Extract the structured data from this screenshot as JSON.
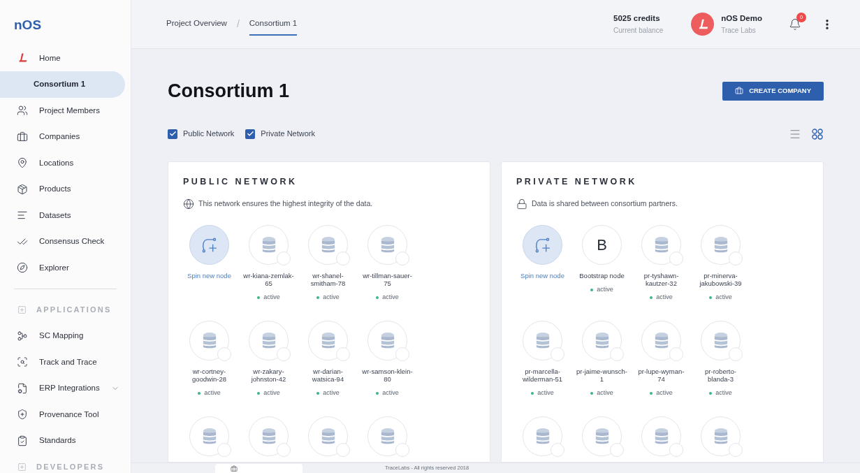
{
  "sidebar": {
    "logo": "nOS",
    "items": [
      {
        "kind": "item",
        "label": "Home",
        "selected": false
      },
      {
        "kind": "item",
        "label": "Consortium 1",
        "selected": true
      },
      {
        "kind": "item",
        "label": "Project Members",
        "selected": false
      },
      {
        "kind": "item",
        "label": "Companies",
        "selected": false
      },
      {
        "kind": "item",
        "label": "Locations",
        "selected": false
      },
      {
        "kind": "item",
        "label": "Products",
        "selected": false
      },
      {
        "kind": "item",
        "label": "Datasets",
        "selected": false
      },
      {
        "kind": "item",
        "label": "Consensus Check",
        "selected": false
      },
      {
        "kind": "item",
        "label": "Explorer",
        "selected": false
      },
      {
        "kind": "divider"
      },
      {
        "kind": "section",
        "label": "APPLICATIONS"
      },
      {
        "kind": "item",
        "label": "SC Mapping",
        "selected": false
      },
      {
        "kind": "item",
        "label": "Track and Trace",
        "selected": false
      },
      {
        "kind": "item",
        "label": "ERP Integrations",
        "selected": false,
        "expanded": false
      },
      {
        "kind": "item",
        "label": "Provenance Tool",
        "selected": false
      },
      {
        "kind": "item",
        "label": "Standards",
        "selected": false
      },
      {
        "kind": "section",
        "label": "DEVELOPERS"
      }
    ]
  },
  "breadcrumb_separator": "/",
  "breadcrumbs": [
    {
      "label": "Project Overview",
      "selected": false
    },
    {
      "label": "Consortium 1",
      "selected": true
    }
  ],
  "account": {
    "credits": "5025 credits",
    "credits_caption": "Current balance",
    "user": "nOS Demo",
    "company": "Trace Labs",
    "notifications": "0"
  },
  "page": {
    "title": "Consortium 1",
    "create_button": "CREATE COMPANY"
  },
  "filters": [
    {
      "label": "Public Network",
      "checked": true
    },
    {
      "label": "Private Network",
      "checked": true
    }
  ],
  "view_toggle": [
    {
      "kind": "list",
      "selected": false
    },
    {
      "kind": "grid",
      "selected": true
    }
  ],
  "networks": [
    {
      "title": "PUBLIC NETWORK",
      "kind": "public",
      "description": "This network ensures the highest integrity of the data.",
      "nodes": [
        {
          "kind": "spin",
          "label": "Spin new node"
        },
        {
          "kind": "db",
          "label": "wr-kiana-zemlak-65",
          "status": "active"
        },
        {
          "kind": "db",
          "label": "wr-shanel-smitham-78",
          "status": "active"
        },
        {
          "kind": "db",
          "label": "wr-tillman-sauer-75",
          "status": "active"
        },
        {
          "kind": "db",
          "label": "wr-cortney-goodwin-28",
          "status": "active"
        },
        {
          "kind": "db",
          "label": "wr-zakary-johnston-42",
          "status": "active"
        },
        {
          "kind": "db",
          "label": "wr-darian-watsica-94",
          "status": "active"
        },
        {
          "kind": "db",
          "label": "wr-samson-klein-80",
          "status": "active"
        },
        {
          "kind": "db"
        },
        {
          "kind": "db"
        },
        {
          "kind": "db"
        },
        {
          "kind": "db"
        }
      ]
    },
    {
      "title": "PRIVATE NETWORK",
      "kind": "private",
      "description": "Data is shared between consortium partners.",
      "nodes": [
        {
          "kind": "spin",
          "label": "Spin new node"
        },
        {
          "kind": "bootstrap",
          "glyph": "B",
          "label": "Bootstrap node",
          "status": "active"
        },
        {
          "kind": "db",
          "label": "pr-tyshawn-kautzer-32",
          "status": "active"
        },
        {
          "kind": "db",
          "label": "pr-minerva-jakubowski-39",
          "status": "active"
        },
        {
          "kind": "db",
          "label": "pr-marcella-wilderman-51",
          "status": "active"
        },
        {
          "kind": "db",
          "label": "pr-jaime-wunsch-1",
          "status": "active"
        },
        {
          "kind": "db",
          "label": "pr-lupe-wyman-74",
          "status": "active"
        },
        {
          "kind": "db",
          "label": "pr-roberto-blanda-3",
          "status": "active"
        },
        {
          "kind": "db"
        },
        {
          "kind": "db"
        },
        {
          "kind": "db"
        },
        {
          "kind": "db"
        }
      ]
    }
  ],
  "footer": "TraceLabs - All rights reserved 2018"
}
